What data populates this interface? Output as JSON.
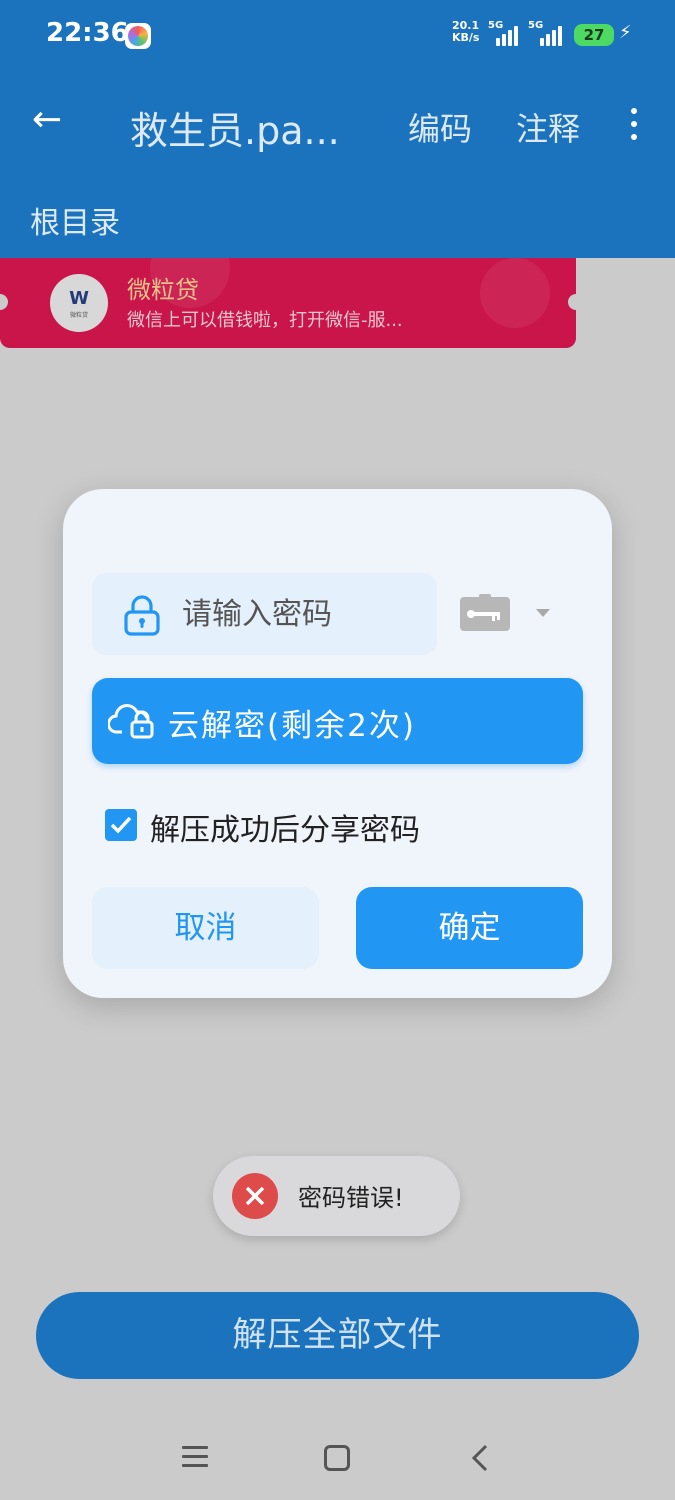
{
  "status_bar": {
    "time": "22:36",
    "net_speed_value": "20.1",
    "net_speed_unit": "KB/s",
    "sim1": "5G",
    "sim2": "5G",
    "battery": "27"
  },
  "app_bar": {
    "title": "救生员.pa...",
    "action_encoding": "编码",
    "action_comment": "注释",
    "breadcrumb": "根目录"
  },
  "ad": {
    "logo_text": "W",
    "logo_sub": "微粒贷",
    "title": "微粒贷",
    "description": "微信上可以借钱啦，打开微信-服..."
  },
  "dialog": {
    "password_placeholder": "请输入密码",
    "password_value": "",
    "cloud_decrypt_label": "云解密(剩余2次)",
    "share_checkbox_label": "解压成功后分享密码",
    "share_checked": true,
    "cancel_label": "取消",
    "confirm_label": "确定"
  },
  "toast": {
    "message": "密码错误!"
  },
  "bottom": {
    "extract_all_label": "解压全部文件"
  },
  "colors": {
    "primary": "#2196f3",
    "appbar_dimmed": "#1b72bd",
    "ad_background": "#c91549",
    "error": "#dd4b4b"
  }
}
